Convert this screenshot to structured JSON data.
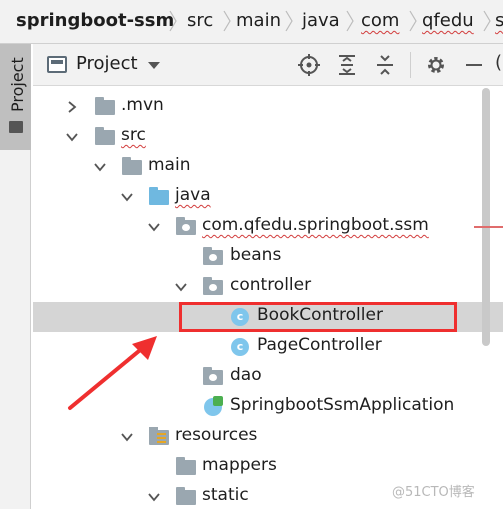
{
  "breadcrumb": {
    "items": [
      "springboot-ssm",
      "src",
      "main",
      "java",
      "com",
      "qfedu",
      "s"
    ]
  },
  "side_stripe": {
    "tab_label": "Project"
  },
  "project_panel": {
    "title": "Project",
    "header_cut_text": "("
  },
  "tree": [
    {
      "label": ".mvn",
      "icon": "folder-icon",
      "expanded": false
    },
    {
      "label": "src",
      "icon": "folder-icon",
      "expanded": true
    },
    {
      "label": "main",
      "icon": "folder-icon",
      "expanded": true
    },
    {
      "label": "java",
      "icon": "source-root-folder-icon",
      "expanded": true
    },
    {
      "label": "com.qfedu.springboot.ssm",
      "icon": "package-icon",
      "expanded": true
    },
    {
      "label": "beans",
      "icon": "package-icon",
      "expanded": false
    },
    {
      "label": "controller",
      "icon": "package-icon",
      "expanded": true
    },
    {
      "label": "BookController",
      "icon": "class-icon",
      "selected": true
    },
    {
      "label": "PageController",
      "icon": "class-icon"
    },
    {
      "label": "dao",
      "icon": "package-icon"
    },
    {
      "label": "SpringbootSsmApplication",
      "icon": "spring-boot-app-icon"
    },
    {
      "label": "resources",
      "icon": "resources-folder-icon",
      "expanded": true
    },
    {
      "label": "mappers",
      "icon": "folder-icon"
    },
    {
      "label": "static",
      "icon": "folder-icon",
      "expanded": true
    }
  ],
  "watermark": "@51CTO博客",
  "colors": {
    "highlight_box": "#ef2f2f",
    "selection": "#d5d5d5",
    "class_icon": "#7fc6ec",
    "source_folder": "#6fb8e0"
  }
}
